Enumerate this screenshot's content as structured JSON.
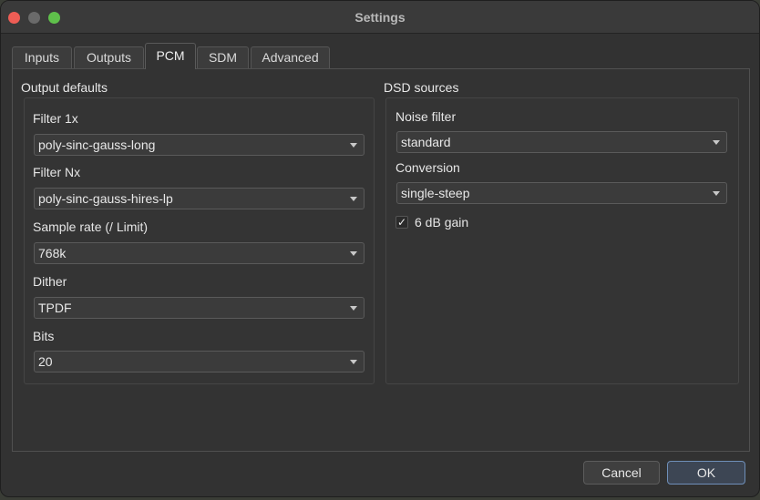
{
  "window": {
    "title": "Settings"
  },
  "tabs": [
    {
      "label": "Inputs",
      "active": false
    },
    {
      "label": "Outputs",
      "active": false
    },
    {
      "label": "PCM",
      "active": true
    },
    {
      "label": "SDM",
      "active": false
    },
    {
      "label": "Advanced",
      "active": false
    }
  ],
  "output_defaults": {
    "title": "Output defaults",
    "fields": [
      {
        "label": "Filter 1x",
        "value": "poly-sinc-gauss-long"
      },
      {
        "label": "Filter Nx",
        "value": "poly-sinc-gauss-hires-lp"
      },
      {
        "label": "Sample rate (/ Limit)",
        "value": "768k"
      },
      {
        "label": "Dither",
        "value": "TPDF"
      },
      {
        "label": "Bits",
        "value": "20"
      }
    ]
  },
  "dsd_sources": {
    "title": "DSD sources",
    "fields": [
      {
        "label": "Noise filter",
        "value": "standard"
      },
      {
        "label": "Conversion",
        "value": "single-steep"
      }
    ],
    "gain_checkbox": {
      "label": "6 dB gain",
      "checked": true,
      "mark": "✓"
    }
  },
  "buttons": {
    "cancel": "Cancel",
    "ok": "OK"
  },
  "colors": {
    "accent_border": "#6f8fb8",
    "close": "#ee5d55",
    "zoom": "#5fc04b"
  }
}
